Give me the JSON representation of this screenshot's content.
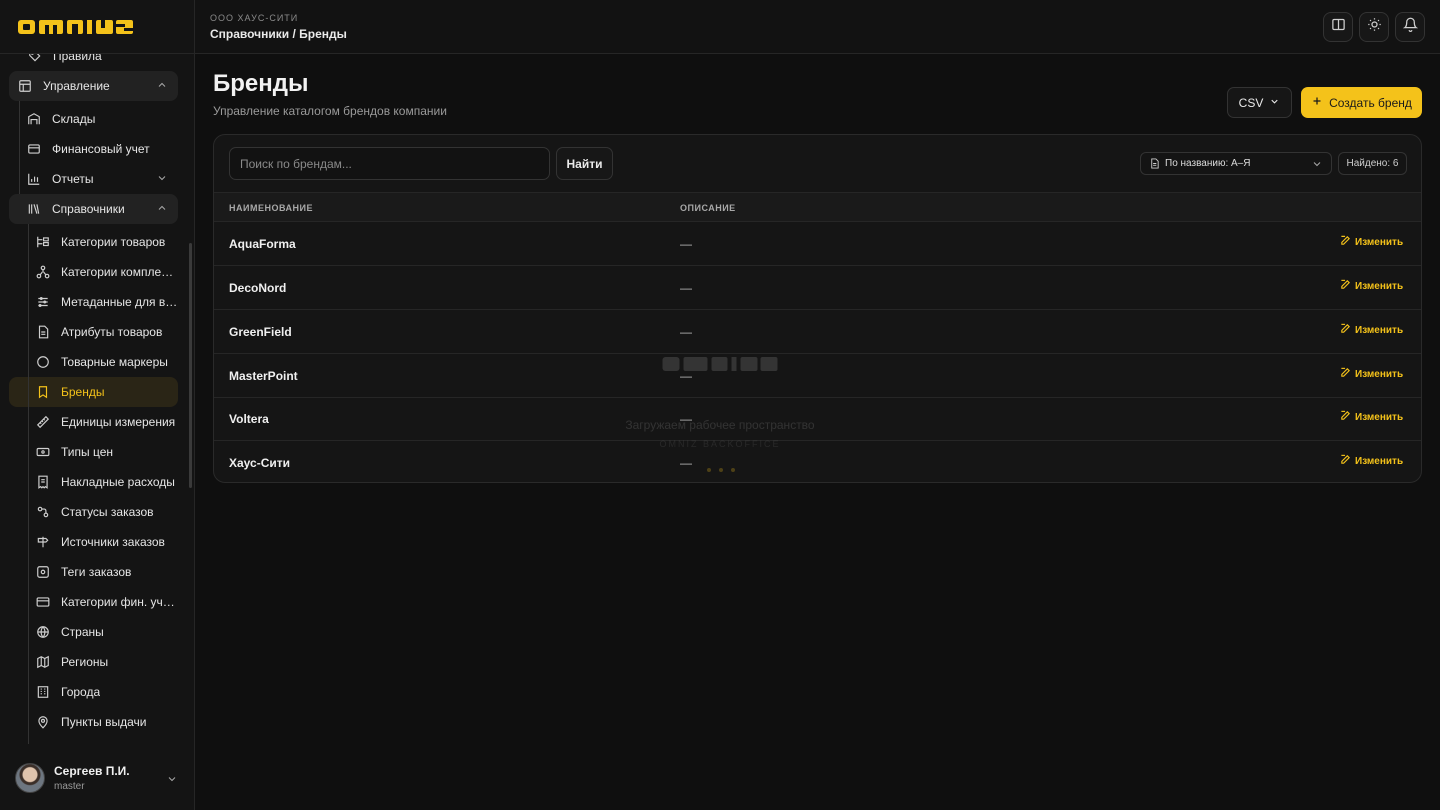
{
  "app": {
    "logo_text": "OMNIZ"
  },
  "header": {
    "company": "ООО ХАУС-СИТИ",
    "breadcrumb": "Справочники / Бренды"
  },
  "sidebar": {
    "items": [
      {
        "label": "Правила",
        "icon": "tag-icon"
      },
      {
        "label": "Управление",
        "icon": "layout-icon",
        "expanded": true
      },
      {
        "label": "Склады",
        "icon": "warehouse-icon"
      },
      {
        "label": "Финансовый учет",
        "icon": "wallet-icon"
      },
      {
        "label": "Отчеты",
        "icon": "chart-icon",
        "expanded": false
      },
      {
        "label": "Справочники",
        "icon": "library-icon",
        "expanded": true
      },
      {
        "label": "Категории товаров",
        "icon": "category-tree-icon"
      },
      {
        "label": "Категории компле…",
        "icon": "network-icon"
      },
      {
        "label": "Метаданные для в…",
        "icon": "sliders-icon"
      },
      {
        "label": "Атрибуты товаров",
        "icon": "file-list-icon"
      },
      {
        "label": "Товарные маркеры",
        "icon": "circle-icon"
      },
      {
        "label": "Бренды",
        "icon": "bookmark-icon",
        "active": true
      },
      {
        "label": "Единицы измерения",
        "icon": "ruler-icon"
      },
      {
        "label": "Типы цен",
        "icon": "banknote-icon"
      },
      {
        "label": "Накладные расходы",
        "icon": "receipt-icon"
      },
      {
        "label": "Статусы заказов",
        "icon": "status-icon"
      },
      {
        "label": "Источники заказов",
        "icon": "signpost-icon"
      },
      {
        "label": "Теги заказов",
        "icon": "scan-tag-icon"
      },
      {
        "label": "Категории фин. уч…",
        "icon": "credit-card-icon"
      },
      {
        "label": "Страны",
        "icon": "globe-icon"
      },
      {
        "label": "Регионы",
        "icon": "map-icon"
      },
      {
        "label": "Города",
        "icon": "building-icon"
      },
      {
        "label": "Пункты выдачи",
        "icon": "map-pin-icon"
      }
    ]
  },
  "user": {
    "name": "Сергеев П.И.",
    "role": "master"
  },
  "page": {
    "title": "Бренды",
    "subtitle": "Управление каталогом брендов компании",
    "csv_label": "CSV",
    "create_label": "Создать бренд"
  },
  "toolbar": {
    "search_placeholder": "Поиск по брендам...",
    "find_label": "Найти",
    "sort_label": "По названию: А–Я",
    "found_label": "Найдено: 6"
  },
  "table": {
    "columns": [
      "НАИМЕНОВАНИЕ",
      "ОПИСАНИЕ"
    ],
    "edit_label": "Изменить",
    "rows": [
      {
        "name": "AquaForma",
        "description": "—"
      },
      {
        "name": "DecoNord",
        "description": "—"
      },
      {
        "name": "GreenField",
        "description": "—"
      },
      {
        "name": "MasterPoint",
        "description": "—"
      },
      {
        "name": "Voltera",
        "description": "—"
      },
      {
        "name": "Хаус-Сити",
        "description": "—"
      }
    ]
  },
  "loader": {
    "text": "Загружаем рабочее пространство",
    "subtext": "OMNIZ BACKOFFICE"
  },
  "colors": {
    "accent": "#f4c21a",
    "background": "#0f0f0f"
  }
}
